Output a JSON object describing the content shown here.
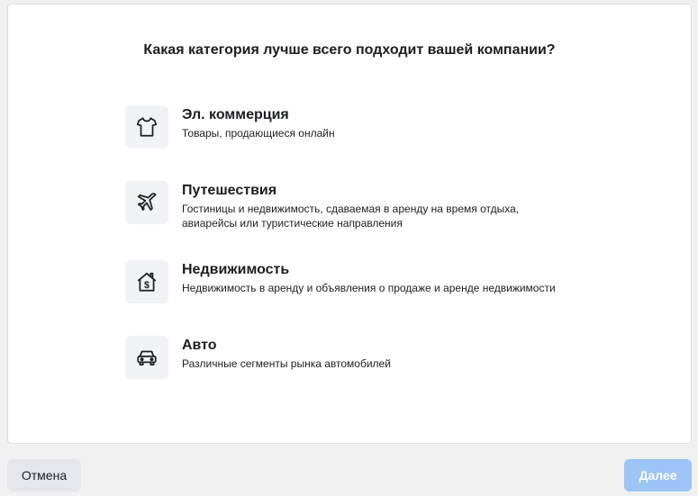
{
  "question": "Какая категория лучше всего подходит вашей компании?",
  "options": [
    {
      "title": "Эл. коммерция",
      "description": "Товары, продающиеся онлайн",
      "icon": "tshirt-icon"
    },
    {
      "title": "Путешествия",
      "description": "Гостиницы и недвижимость, сдаваемая в аренду на время отдыха, авиарейсы или туристические направления",
      "icon": "airplane-icon"
    },
    {
      "title": "Недвижимость",
      "description": "Недвижимость в аренду и объявления о продаже и аренде недвижимости",
      "icon": "house-dollar-icon"
    },
    {
      "title": "Авто",
      "description": "Различные сегменты рынка автомобилей",
      "icon": "car-icon"
    }
  ],
  "footer": {
    "cancel_label": "Отмена",
    "next_label": "Далее"
  },
  "colors": {
    "page_bg": "#f0f0f0",
    "card_bg": "#ffffff",
    "icon_bg": "#f0f2f5",
    "next_disabled": "#9cc4f4"
  }
}
